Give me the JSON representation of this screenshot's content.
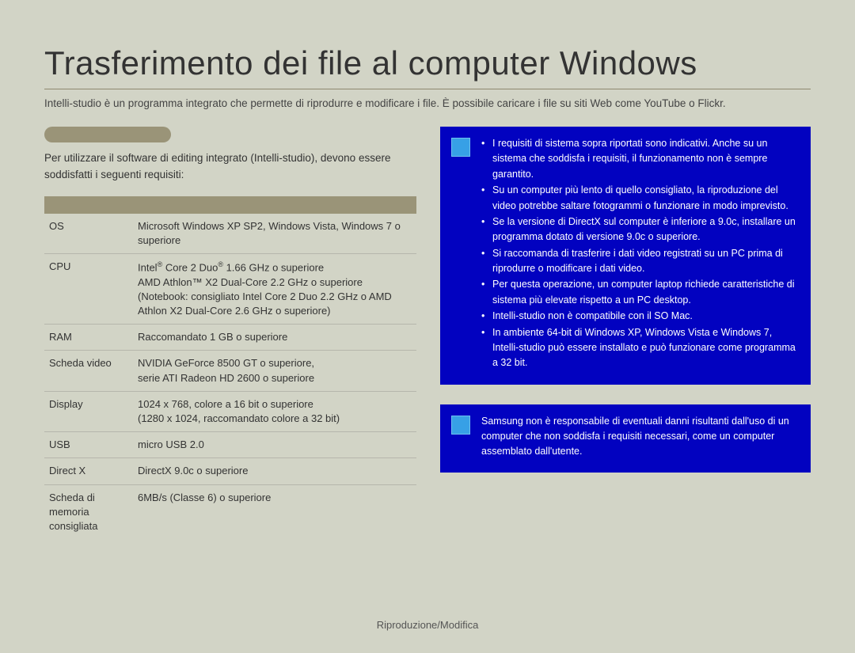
{
  "title": "Trasferimento dei file al computer Windows",
  "intro": "Intelli-studio è un programma integrato che permette di riprodurre e modificare i file. È possibile caricare i file su siti Web come YouTube o Flickr.",
  "subhead_text": "Per utilizzare il software di editing integrato (Intelli-studio), devono essere soddisfatti i seguenti requisiti:",
  "table": {
    "rows": [
      {
        "label": "OS",
        "value": "Microsoft Windows XP SP2, Windows Vista, Windows 7 o superiore"
      },
      {
        "label": "CPU",
        "value": "Intel® Core 2 Duo® 1.66 GHz o superiore\nAMD Athlon™ X2 Dual-Core 2.2 GHz o superiore\n(Notebook: consigliato Intel Core 2 Duo 2.2 GHz o AMD Athlon X2 Dual-Core 2.6 GHz o superiore)"
      },
      {
        "label": "RAM",
        "value": "Raccomandato 1 GB o superiore"
      },
      {
        "label": "Scheda video",
        "value": "NVIDIA GeForce 8500 GT o superiore, serie ATI Radeon HD 2600 o superiore"
      },
      {
        "label": "Display",
        "value": "1024 x 768, colore a 16 bit o superiore (1280 x 1024, raccomandato colore a 32 bit)"
      },
      {
        "label": "USB",
        "value": "micro USB 2.0"
      },
      {
        "label": "Direct X",
        "value": "DirectX 9.0c o superiore"
      },
      {
        "label": "Scheda di memoria consigliata",
        "value": "6MB/s (Classe 6) o superiore"
      }
    ]
  },
  "info1": {
    "items": [
      "I requisiti di sistema sopra riportati sono indicativi. Anche su un sistema che soddisfa i requisiti, il funzionamento non è sempre garantito.",
      "Su un computer più lento di quello consigliato, la riproduzione del video potrebbe saltare fotogrammi o funzionare in modo imprevisto.",
      "Se la versione di DirectX sul computer è inferiore a 9.0c, installare un programma dotato di versione 9.0c o superiore.",
      "Si raccomanda di trasferire i dati video registrati su un PC prima di riprodurre o modificare i dati video.",
      "Per questa operazione, un computer laptop richiede caratteristiche di sistema più elevate rispetto a un PC desktop.",
      "Intelli-studio non è compatibile con il SO Mac.",
      "In ambiente 64-bit di Windows XP, Windows Vista e Windows 7, Intelli-studio può essere installato e può funzionare come programma a 32 bit."
    ]
  },
  "info2": {
    "text": "Samsung non è responsabile di eventuali danni risultanti dall'uso di un computer che non soddisfa i requisiti necessari, come un computer assemblato dall'utente."
  },
  "footer": "Riproduzione/Modifica"
}
